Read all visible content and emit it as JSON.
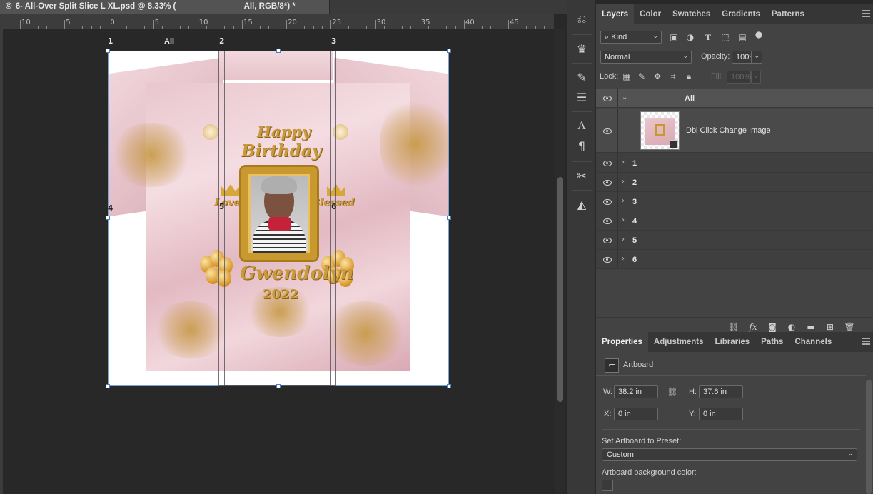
{
  "document": {
    "tab_title": "6- All-Over Split Slice L XL.psd @ 8.33% (",
    "tab_mode": "All, RGB/8*) *",
    "close_glyph": "©"
  },
  "ruler": {
    "labels": [
      "10",
      "5",
      "0",
      "5",
      "10",
      "15",
      "20",
      "25",
      "30",
      "35",
      "40",
      "45"
    ]
  },
  "artboard": {
    "name": "All",
    "slice_numbers": [
      "1",
      "2",
      "3",
      "4",
      "5",
      "6"
    ]
  },
  "design": {
    "line1": "Happy",
    "line2": "Birthday",
    "left_word": "Loved",
    "right_word": "Blessed",
    "name": "Gwendolyn",
    "year": "2022"
  },
  "toolstrip": {
    "icons": [
      "history-icon",
      "brush-preset-icon",
      "brush-settings-icon",
      "adjustments-icon",
      "character-icon",
      "paragraph-icon",
      "tools-icon",
      "shapes-icon"
    ]
  },
  "layers_panel": {
    "tabs": [
      "Layers",
      "Color",
      "Swatches",
      "Gradients",
      "Patterns"
    ],
    "active_tab": "Layers",
    "filter_kind": "Kind",
    "blend_mode": "Normal",
    "opacity_label": "Opacity:",
    "opacity_value": "100%",
    "lock_label": "Lock:",
    "fill_label": "Fill:",
    "fill_value": "100%",
    "layers": [
      {
        "name": "All",
        "type": "group-open"
      },
      {
        "name": "Dbl Click Change Image",
        "type": "smart-object"
      },
      {
        "name": "1",
        "type": "group"
      },
      {
        "name": "2",
        "type": "group"
      },
      {
        "name": "3",
        "type": "group"
      },
      {
        "name": "4",
        "type": "group"
      },
      {
        "name": "5",
        "type": "group"
      },
      {
        "name": "6",
        "type": "group"
      }
    ],
    "footer_icons": [
      "link-icon",
      "fx-icon",
      "mask-icon",
      "adjustment-layer-icon",
      "folder-icon",
      "new-layer-icon",
      "trash-icon"
    ]
  },
  "properties_panel": {
    "tabs": [
      "Properties",
      "Adjustments",
      "Libraries",
      "Paths",
      "Channels"
    ],
    "active_tab": "Properties",
    "object_type": "Artboard",
    "w_label": "W:",
    "w_value": "38.2 in",
    "h_label": "H:",
    "h_value": "37.6 in",
    "x_label": "X:",
    "x_value": "0 in",
    "y_label": "Y:",
    "y_value": "0 in",
    "preset_label": "Set Artboard to Preset:",
    "preset_value": "Custom",
    "bg_color_label": "Artboard background color:"
  }
}
